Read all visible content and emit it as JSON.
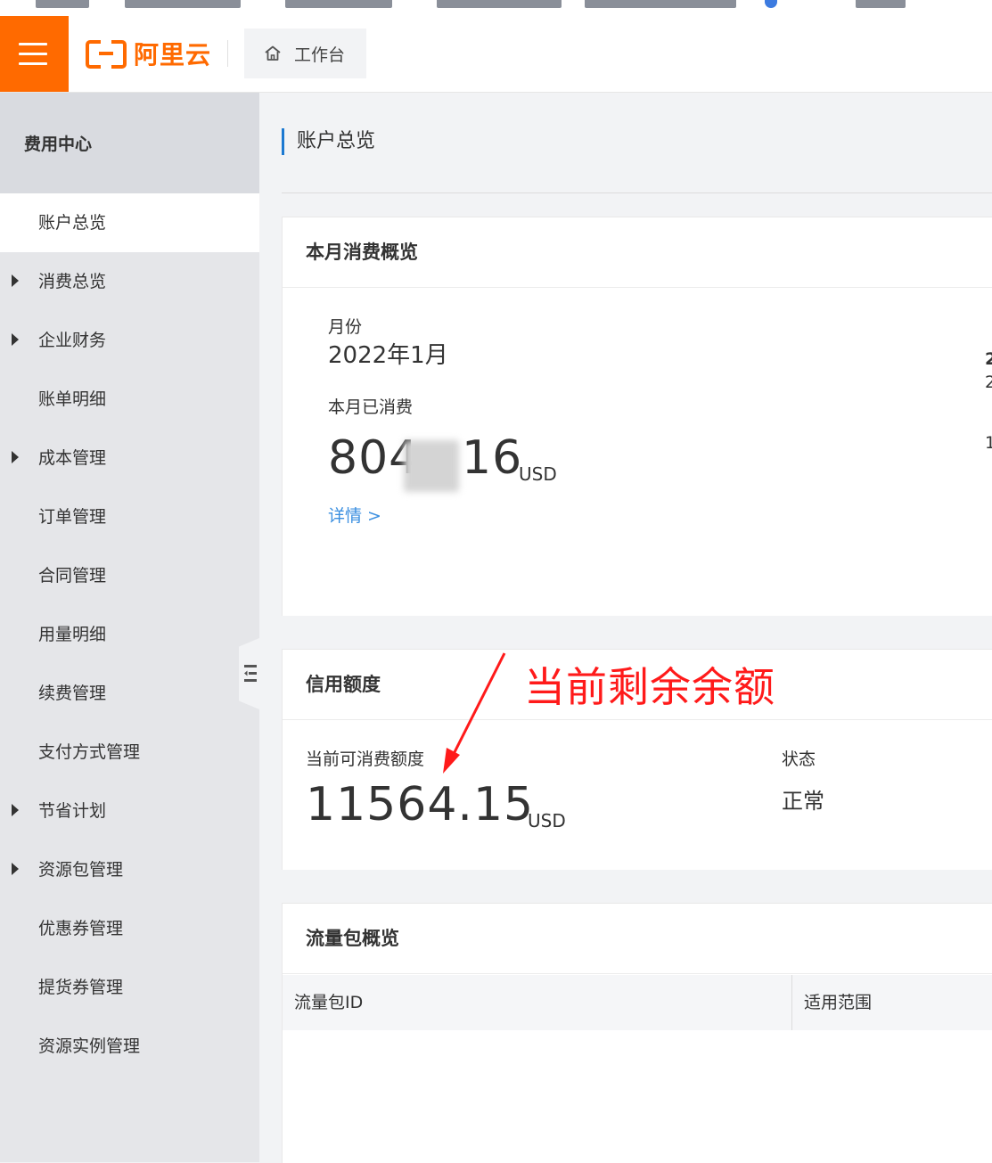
{
  "header": {
    "logo_text": "阿里云",
    "workbench_label": "工作台"
  },
  "sidebar": {
    "title": "费用中心",
    "items": [
      {
        "label": "账户总览",
        "active": true,
        "expandable": false
      },
      {
        "label": "消费总览",
        "expandable": true
      },
      {
        "label": "企业财务",
        "expandable": true
      },
      {
        "label": "账单明细",
        "expandable": false
      },
      {
        "label": "成本管理",
        "expandable": true
      },
      {
        "label": "订单管理",
        "expandable": false
      },
      {
        "label": "合同管理",
        "expandable": false
      },
      {
        "label": "用量明细",
        "expandable": false
      },
      {
        "label": "续费管理",
        "expandable": false
      },
      {
        "label": "支付方式管理",
        "expandable": false
      },
      {
        "label": "节省计划",
        "expandable": true
      },
      {
        "label": "资源包管理",
        "expandable": true
      },
      {
        "label": "优惠券管理",
        "expandable": false
      },
      {
        "label": "提货券管理",
        "expandable": false
      },
      {
        "label": "资源实例管理",
        "expandable": false
      }
    ]
  },
  "page": {
    "title": "账户总览"
  },
  "monthly": {
    "title": "本月消费概览",
    "month_label": "月份",
    "month_value": "2022年1月",
    "spent_label": "本月已消费",
    "spent_prefix": "804",
    "spent_suffix": "16",
    "spent_unit": "USD",
    "details_link": "详情 >",
    "right_edge": [
      "2",
      "2",
      "1"
    ]
  },
  "credit": {
    "title": "信用额度",
    "available_label": "当前可消费额度",
    "available_value": "11564.15",
    "available_unit": "USD",
    "status_label": "状态",
    "status_value": "正常"
  },
  "traffic": {
    "title": "流量包概览",
    "columns": [
      "流量包ID",
      "适用范围"
    ]
  },
  "annotation": {
    "text": "当前剩余余额",
    "color": "#ff1a1a"
  },
  "colors": {
    "brand": "#ff6a00",
    "link": "#3b8fe0",
    "title_accent": "#1c79d1"
  }
}
